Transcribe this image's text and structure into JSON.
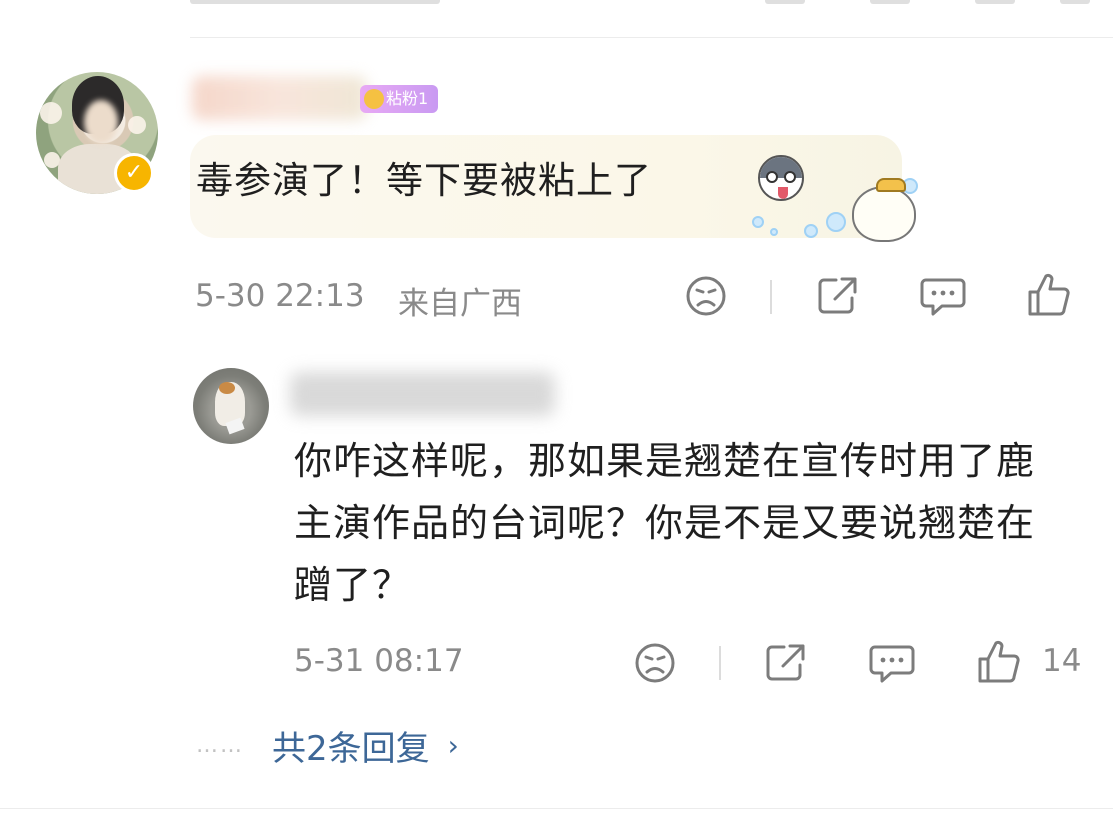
{
  "main_comment": {
    "fan_badge": "粘粉1",
    "text": "毒参演了！等下要被粘上了",
    "timestamp": "5-30 22:13",
    "location": "来自广西",
    "like_count": ""
  },
  "reply": {
    "text": "你咋这样呢，那如果是翘楚在宣传时用了鹿主演作品的台词呢？你是不是又要说翘楚在蹭了？",
    "timestamp": "5-31 08:17",
    "like_count": "14"
  },
  "more_replies": {
    "dots": "……",
    "label": "共2条回复",
    "chevron": "›"
  },
  "icons": [
    "dislike-face-icon",
    "share-icon",
    "comment-icon",
    "like-thumb-icon",
    "verified-badge-icon",
    "husky-emoji-icon",
    "mascot-sticker-icon"
  ],
  "colors": {
    "link_blue": "#3d6797",
    "meta_gray": "#8a8a8a",
    "verified_yellow": "#f7b500",
    "fan_badge": "#d9a0f3",
    "bubble_bg": "#fbf8ef"
  }
}
